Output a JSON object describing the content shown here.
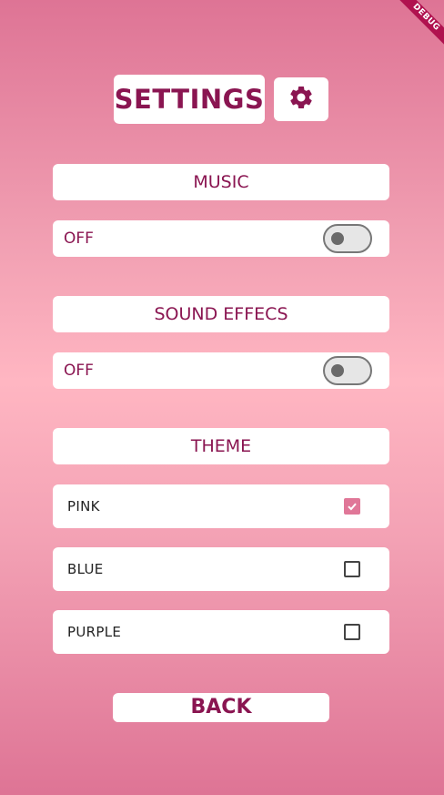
{
  "debug_banner": "DEBUG",
  "header": {
    "title": "SETTINGS",
    "settings_icon": "gear-icon"
  },
  "music": {
    "title": "MUSIC",
    "toggle_label": "OFF",
    "enabled": false
  },
  "sound_effects": {
    "title": "SOUND EFFECS",
    "toggle_label": "OFF",
    "enabled": false
  },
  "theme": {
    "title": "THEME",
    "options": [
      {
        "label": "PINK",
        "checked": true
      },
      {
        "label": "BLUE",
        "checked": false
      },
      {
        "label": "PURPLE",
        "checked": false
      }
    ]
  },
  "back_label": "BACK",
  "colors": {
    "accent_text": "#8a1551",
    "checkbox_checked": "#e07798",
    "gradient_top": "#de7495",
    "gradient_mid": "#ffb6c2"
  }
}
